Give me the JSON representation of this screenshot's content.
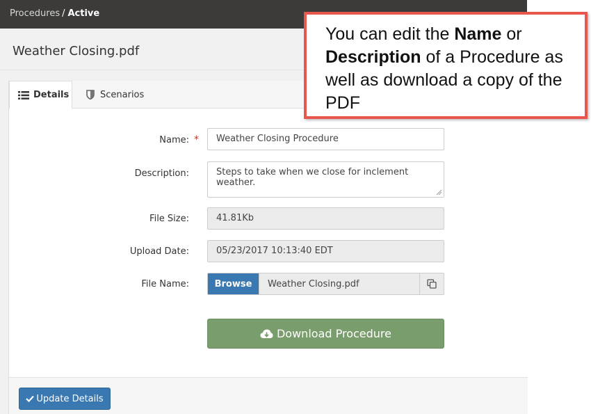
{
  "breadcrumb": {
    "parent": "Procedures",
    "separator": "/",
    "current": "Active"
  },
  "page": {
    "title": "Weather Closing.pdf"
  },
  "tabs": [
    {
      "label": "Details",
      "icon": "list-icon",
      "active": true
    },
    {
      "label": "Scenarios",
      "icon": "shield-icon",
      "active": false
    }
  ],
  "form": {
    "name": {
      "label": "Name:",
      "required_mark": "*",
      "value": "Weather Closing Procedure"
    },
    "description": {
      "label": "Description:",
      "value": "Steps to take when we close for inclement weather."
    },
    "file_size": {
      "label": "File Size:",
      "value": "41.81Kb"
    },
    "upload_date": {
      "label": "Upload Date:",
      "value": "05/23/2017 10:13:40 EDT"
    },
    "file_name": {
      "label": "File Name:",
      "browse_label": "Browse",
      "value": "Weather Closing.pdf"
    }
  },
  "actions": {
    "download_label": "Download Procedure",
    "update_label": "Update Details"
  },
  "callout": {
    "part1": "You can edit the ",
    "bold1": "Name",
    "part2": " or ",
    "bold2": "Description",
    "part3": " of a Procedure as well as download a copy of the PDF"
  },
  "colors": {
    "topbar": "#3c3b39",
    "primary": "#3a78b1",
    "download": "#7a9d6d",
    "required": "#c0392b",
    "callout_border": "#e8564e"
  }
}
